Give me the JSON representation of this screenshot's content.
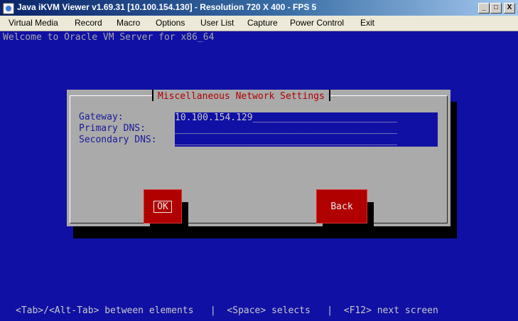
{
  "window": {
    "title": "Java iKVM Viewer v1.69.31 [10.100.154.130]  - Resolution 720 X 400 - FPS 5",
    "minimize": "_",
    "maximize": "□",
    "close": "X"
  },
  "menu": {
    "items": [
      "Virtual Media",
      "Record",
      "Macro",
      "Options",
      "User List",
      "Capture",
      "Power Control",
      "Exit"
    ]
  },
  "console": {
    "welcome": "Welcome to Oracle VM Server for x86_64",
    "dialog": {
      "title": "Miscellaneous Network Settings",
      "fields": [
        {
          "label": "Gateway:",
          "value": "10.100.154.129__________________________"
        },
        {
          "label": "Primary DNS:",
          "value": "________________________________________"
        },
        {
          "label": "Secondary DNS:",
          "value": "________________________________________"
        }
      ],
      "ok_label": "OK",
      "back_label": "Back"
    },
    "status": "<Tab>/<Alt-Tab> between elements   |  <Space> selects   |  <F12> next screen"
  }
}
